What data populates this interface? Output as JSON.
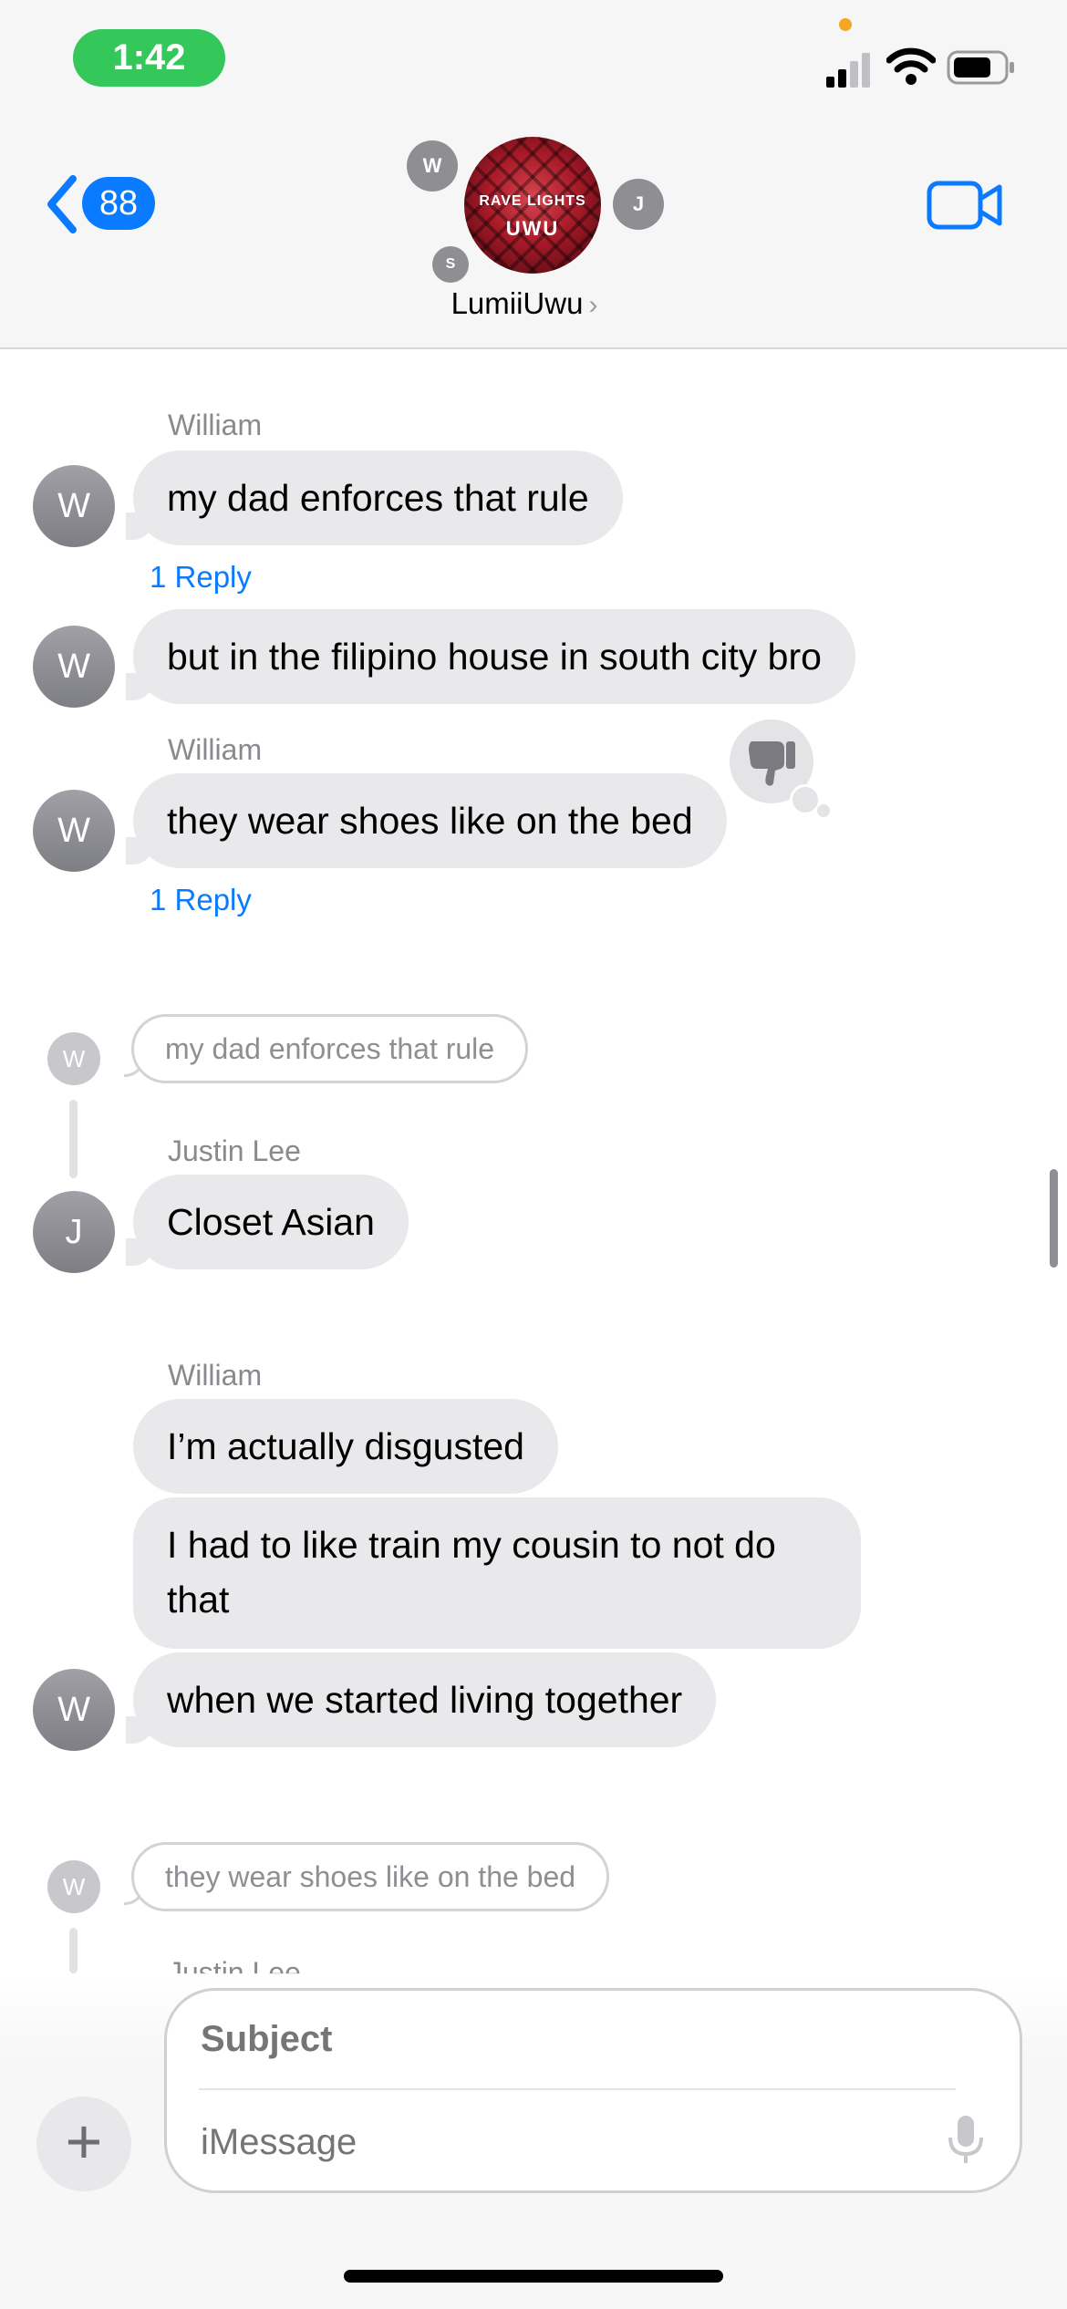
{
  "status_bar": {
    "time": "1:42"
  },
  "header": {
    "back_count": "88",
    "group_name": "LumiiUwu",
    "group_avatar_text_top": "RAVE LIGHTS",
    "group_avatar_text_bottom": "UWU",
    "member_initials": [
      "W",
      "J",
      "S"
    ],
    "icons": [
      "chevron-left-icon",
      "video-camera-icon"
    ]
  },
  "messages": {
    "m1": {
      "sender": "William",
      "text": "my dad enforces that rule",
      "initial": "W",
      "reply_link": "1 Reply"
    },
    "m2": {
      "text": "but in the filipino house in south city bro",
      "initial": "W"
    },
    "m3": {
      "sender": "William",
      "text": "they wear shoes like on the bed",
      "initial": "W",
      "reply_link": "1 Reply",
      "tapback": "thumbs-down-icon"
    },
    "thread1": {
      "quote": "my dad enforces that rule",
      "quote_initial": "W",
      "sender": "Justin Lee",
      "text": "Closet Asian",
      "initial": "J"
    },
    "group2": {
      "sender": "William",
      "lines": [
        "I’m actually disgusted",
        "I had to like train my cousin to not do that",
        "when we started living together"
      ],
      "initial": "W"
    },
    "thread2": {
      "quote": "they wear shoes like on the bed",
      "quote_initial": "W",
      "sender_peek": "Justin Lee"
    }
  },
  "compose": {
    "subject_placeholder": "Subject",
    "message_placeholder": "iMessage",
    "plus_label": "+"
  },
  "colors": {
    "accent": "#0a7aff",
    "bubble_gray": "#e9e9eb",
    "time_pill": "#34c759"
  }
}
